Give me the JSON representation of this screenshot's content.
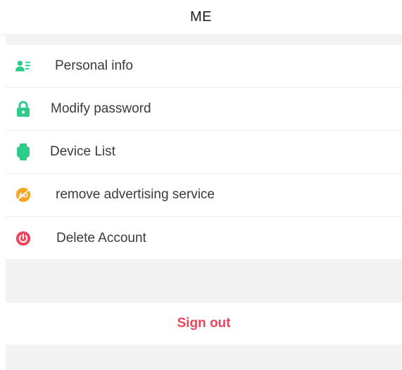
{
  "header": {
    "title": "ME"
  },
  "menu": {
    "items": [
      {
        "label": "Personal info",
        "icon": "person-card-icon",
        "color": "#2ecc8a"
      },
      {
        "label": "Modify password",
        "icon": "lock-icon",
        "color": "#2ecc8a"
      },
      {
        "label": "Device List",
        "icon": "watch-icon",
        "color": "#2ecc8a"
      },
      {
        "label": "remove advertising service",
        "icon": "no-ads-icon",
        "color": "#f5a623"
      },
      {
        "label": "Delete Account",
        "icon": "power-icon",
        "color": "#f0435c"
      }
    ]
  },
  "signout": {
    "label": "Sign out",
    "color": "#f0435c"
  },
  "colors": {
    "accent_green": "#2ecc8a",
    "accent_orange": "#f5a623",
    "accent_red": "#f0435c",
    "background": "#f3f3f3"
  }
}
